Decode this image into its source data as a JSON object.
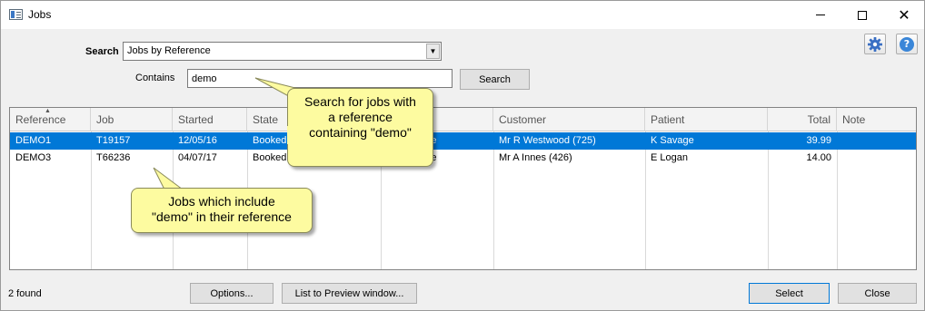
{
  "window": {
    "title": "Jobs"
  },
  "search": {
    "label": "Search",
    "selected_option": "Jobs by Reference",
    "contains_label": "Contains",
    "contains_value": "demo",
    "button_label": "Search"
  },
  "table": {
    "columns": [
      "Reference",
      "Job",
      "Started",
      "State",
      "",
      "Customer",
      "Patient",
      "Total",
      "Note"
    ],
    "rows": [
      {
        "reference": "DEMO1",
        "job": "T19157",
        "started": "12/05/16",
        "state": "Booked C",
        "col5": "ridge",
        "customer": "Mr R Westwood (725)",
        "patient": "K Savage",
        "total": "39.99",
        "note": "",
        "selected": true
      },
      {
        "reference": "DEMO3",
        "job": "T66236",
        "started": "04/07/17",
        "state": "Booked C",
        "col5": "ridge",
        "customer": "Mr A Innes (426)",
        "patient": "E Logan",
        "total": "14.00",
        "note": "",
        "selected": false
      }
    ]
  },
  "status": {
    "found": "2  found"
  },
  "buttons": {
    "options": "Options...",
    "preview": "List to Preview window...",
    "select": "Select",
    "close": "Close"
  },
  "callouts": {
    "search_tip": [
      "Search for jobs with",
      "a reference",
      "containing \"demo\""
    ],
    "results_tip": [
      "Jobs which include",
      "\"demo\" in their reference"
    ]
  },
  "icons": {
    "settings": "gear-icon",
    "help": "help-icon",
    "app": "window-app-icon"
  },
  "colors": {
    "selection": "#0078d7",
    "callout_fill": "#fdfba0",
    "help_blue": "#3a86d8"
  }
}
